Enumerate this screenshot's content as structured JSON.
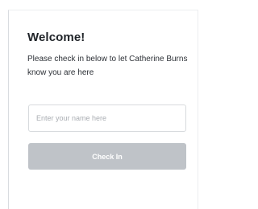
{
  "dialog": {
    "title": "Welcome!",
    "message": "Please check in below to let Catherine Burns know you are here"
  },
  "form": {
    "name_placeholder": "Enter your name here",
    "name_value": "",
    "submit_label": "Check In"
  },
  "colors": {
    "button_background": "#bfc3c8",
    "button_text": "#ffffff",
    "title_text": "#1f2328"
  }
}
